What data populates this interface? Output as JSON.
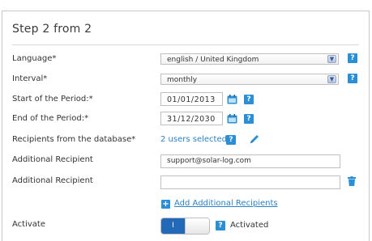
{
  "step_title": "Step 2 from 2",
  "form": {
    "language": {
      "label": "Language*",
      "value": "english / United Kingdom",
      "help": "?"
    },
    "interval": {
      "label": "Interval*",
      "value": "monthly",
      "help": "?"
    },
    "start": {
      "label": "Start of the Period:*",
      "value": "01/01/2013",
      "help": "?"
    },
    "end": {
      "label": "End of the Period:*",
      "value": "31/12/2030",
      "help": "?"
    },
    "recipients_db": {
      "label": "Recipients from the database*",
      "value": "2 users selected",
      "help": "?"
    },
    "additional_1": {
      "label": "Additional Recipient",
      "value": "support@solar-log.com"
    },
    "additional_2": {
      "label": "Additional Recipient",
      "value": ""
    },
    "add_link": {
      "icon": "+",
      "label": "Add Additional Recipients"
    },
    "activate": {
      "label": "Activate",
      "toggle_text": "I",
      "help": "?",
      "status": "Activated"
    }
  },
  "colors": {
    "accent": "#2b8fd6",
    "toggle_on": "#2269b8",
    "link": "#2b7fc4"
  },
  "icons": [
    "chevron-down-icon",
    "calendar-icon",
    "pencil-icon",
    "trash-icon",
    "help-icon",
    "plus-icon"
  ]
}
